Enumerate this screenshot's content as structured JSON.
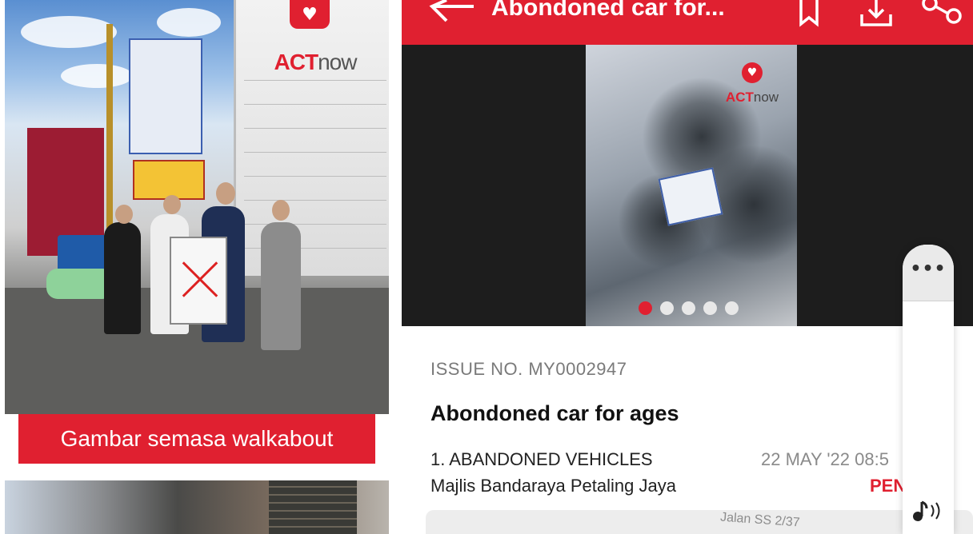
{
  "collage": {
    "caption": "Gambar semasa walkabout",
    "logo": {
      "act": "ACT",
      "now": "now"
    }
  },
  "app": {
    "title": "Abondoned car for...",
    "icons": [
      "back-arrow-icon",
      "bookmark-icon",
      "download-icon",
      "share-icon"
    ],
    "gallery": {
      "photo_count": 5,
      "active_index": 0,
      "logo": {
        "act": "ACT",
        "now": "now"
      }
    },
    "issue": {
      "number": "ISSUE NO. MY0002947",
      "title": "Abondoned car for ages",
      "category": "1. ABANDONED VEHICLES",
      "date": "22 MAY '22 08:5",
      "council": "Majlis Bandaraya Petaling Jaya",
      "status": "PEN"
    },
    "map": {
      "street": "Jalan SS 2/37"
    },
    "floating": {
      "more": "•••",
      "audio_icon": "music-note-icon"
    }
  },
  "colors": {
    "accent": "#e02030",
    "text": "#222222",
    "muted": "#7a7a7a"
  }
}
